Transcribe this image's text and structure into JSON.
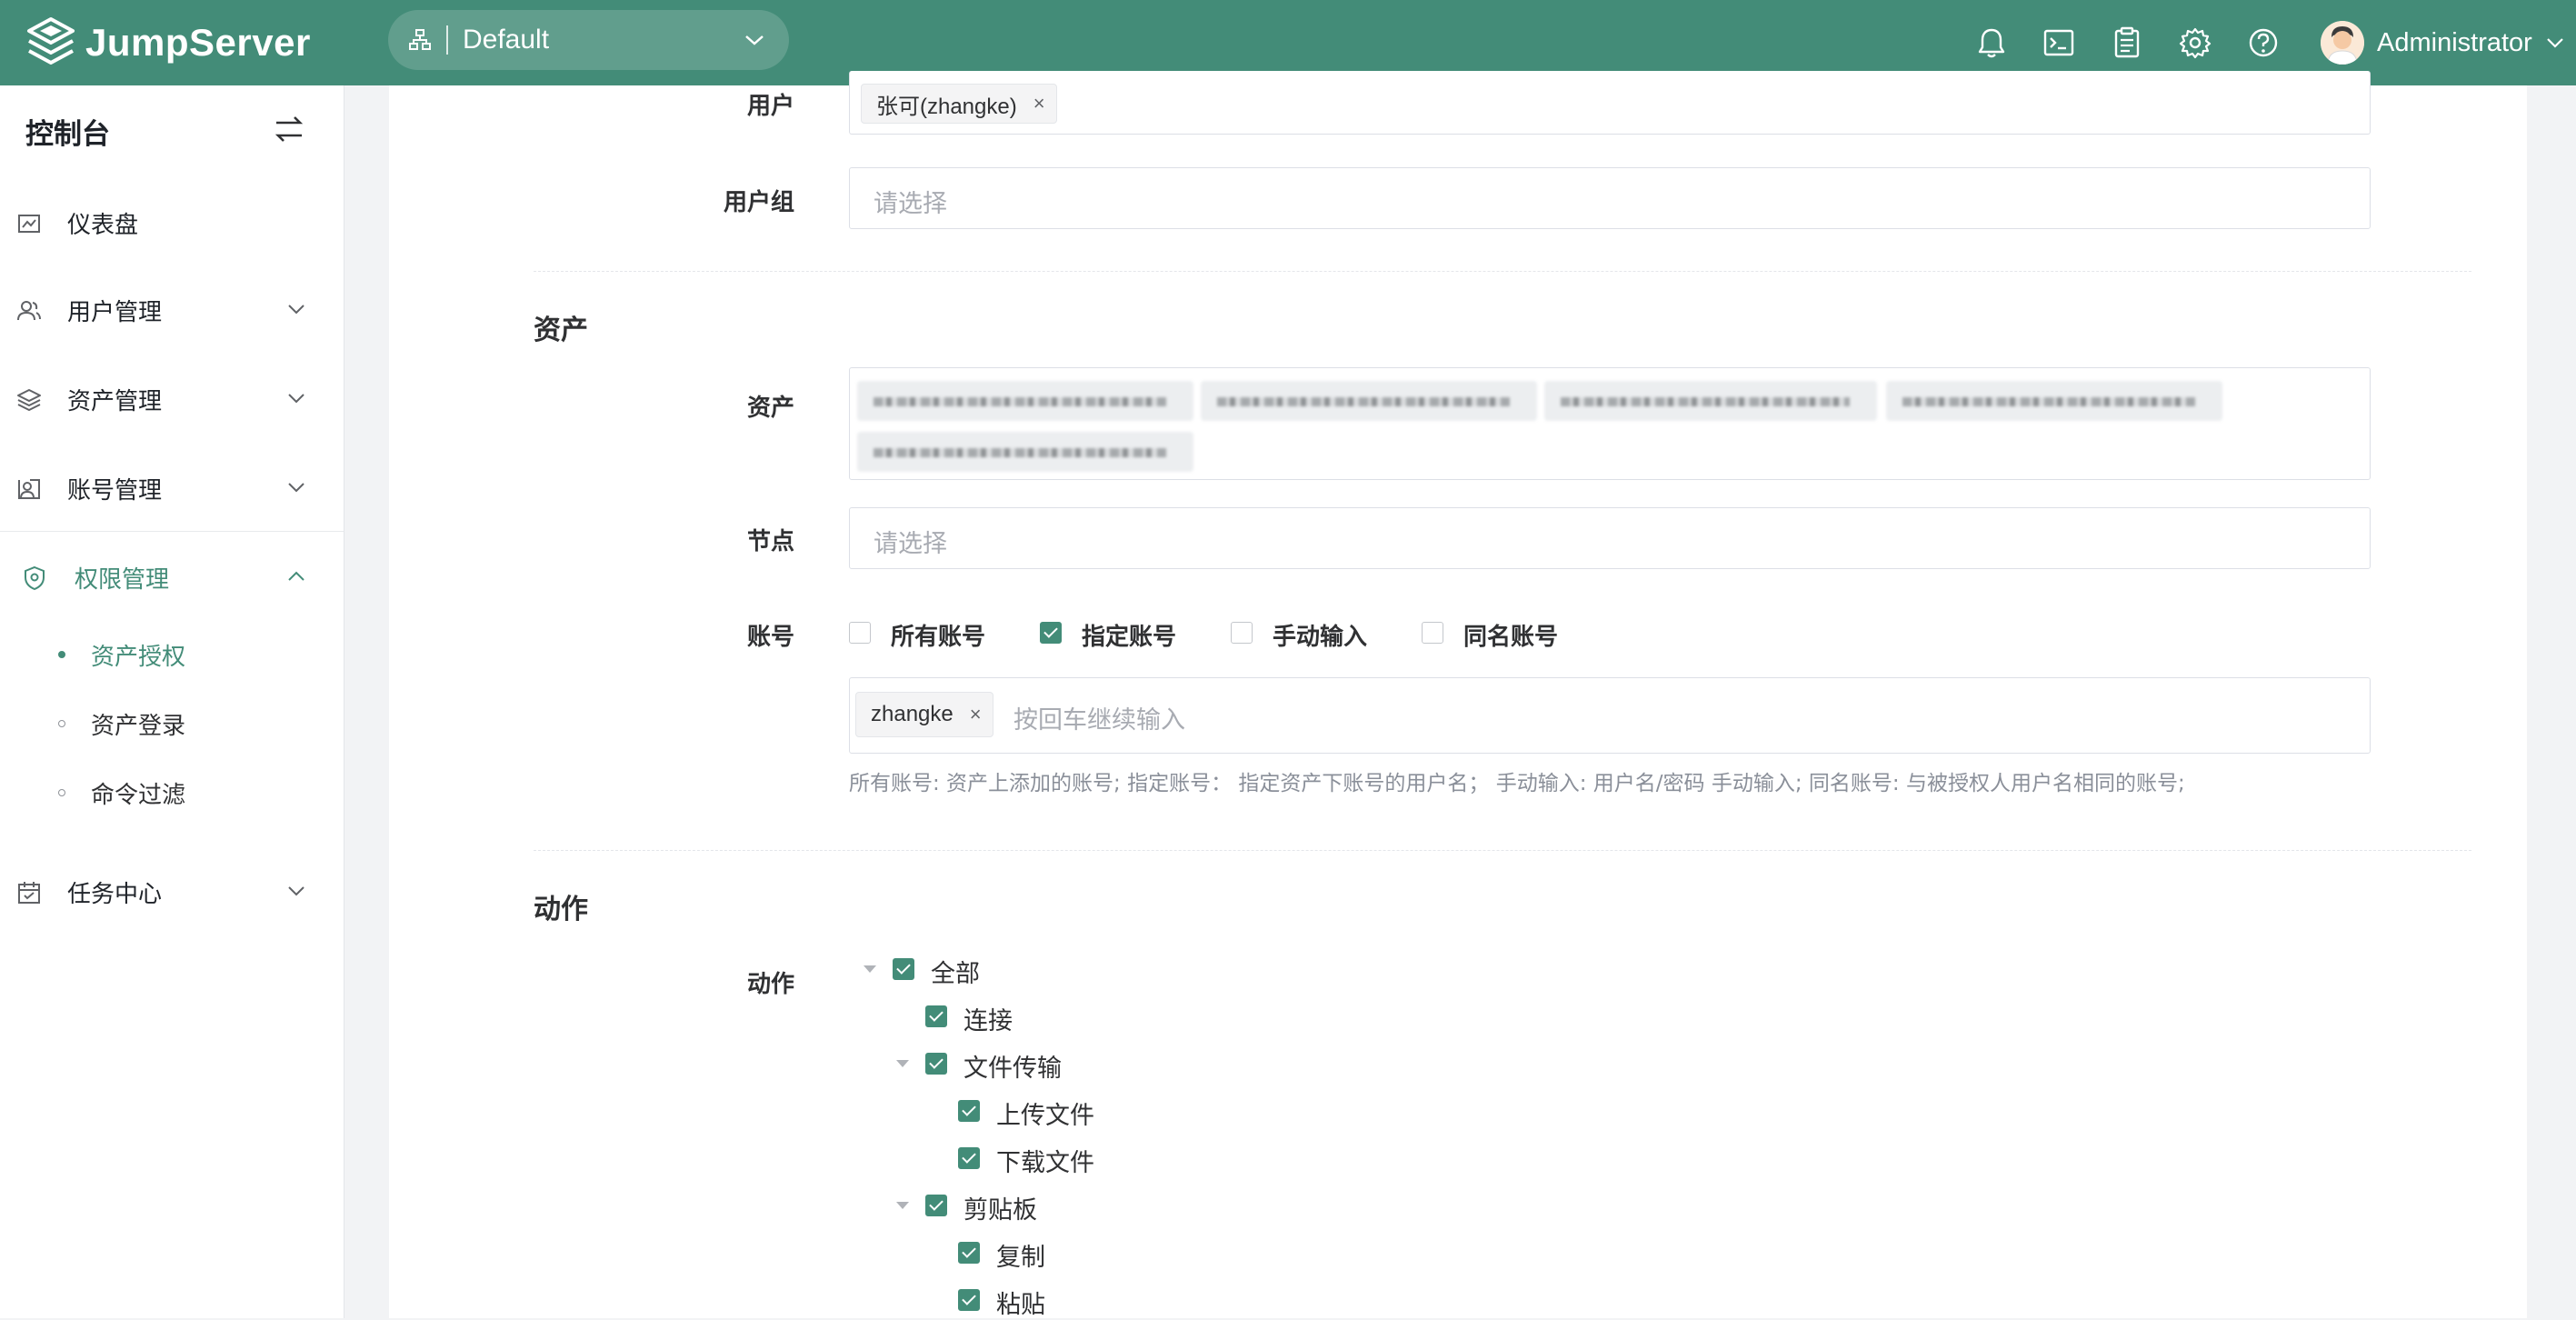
{
  "topbar": {
    "brand": "JumpServer",
    "org_value": "Default",
    "icons": [
      "bell-icon",
      "terminal-icon",
      "clipboard-icon",
      "gear-icon",
      "help-icon"
    ],
    "user_name": "Administrator",
    "bg_color": "#438c78"
  },
  "sidebar": {
    "title": "控制台",
    "items": [
      {
        "label": "仪表盘",
        "icon": "dashboard-icon"
      },
      {
        "label": "用户管理",
        "icon": "users-icon"
      },
      {
        "label": "资产管理",
        "icon": "layers-icon"
      },
      {
        "label": "账号管理",
        "icon": "account-icon"
      },
      {
        "label": "权限管理",
        "icon": "shield-icon",
        "active": true
      },
      {
        "label": "任务中心",
        "icon": "calendar-icon"
      }
    ],
    "subitems": [
      {
        "label": "资产授权",
        "active": true
      },
      {
        "label": "资产登录"
      },
      {
        "label": "命令过滤"
      }
    ]
  },
  "form": {
    "user_label": "用户",
    "user_tag": "张可(zhangke)",
    "user_group_label": "用户组",
    "user_group_placeholder": "请选择",
    "asset_section": "资产",
    "asset_label": "资产",
    "node_label": "节点",
    "node_placeholder": "请选择",
    "account_label": "账号",
    "account_options": [
      {
        "label": "所有账号",
        "checked": false
      },
      {
        "label": "指定账号",
        "checked": true
      },
      {
        "label": "手动输入",
        "checked": false
      },
      {
        "label": "同名账号",
        "checked": false
      }
    ],
    "account_tag": "zhangke",
    "account_input_placeholder": "按回车继续输入",
    "account_hint": "所有账号: 资产上添加的账号; 指定账号： 指定资产下账号的用户名； 手动输入: 用户名/密码 手动输入; 同名账号: 与被授权人用户名相同的账号;",
    "action_section": "动作",
    "action_label": "动作",
    "action_tree": [
      {
        "label": "全部",
        "checked": true
      },
      {
        "label": "连接",
        "checked": true
      },
      {
        "label": "文件传输",
        "checked": true
      },
      {
        "label": "上传文件",
        "checked": true
      },
      {
        "label": "下载文件",
        "checked": true
      },
      {
        "label": "剪贴板",
        "checked": true
      },
      {
        "label": "复制",
        "checked": true
      },
      {
        "label": "粘贴",
        "checked": true
      }
    ],
    "accent_color": "#438c78"
  }
}
